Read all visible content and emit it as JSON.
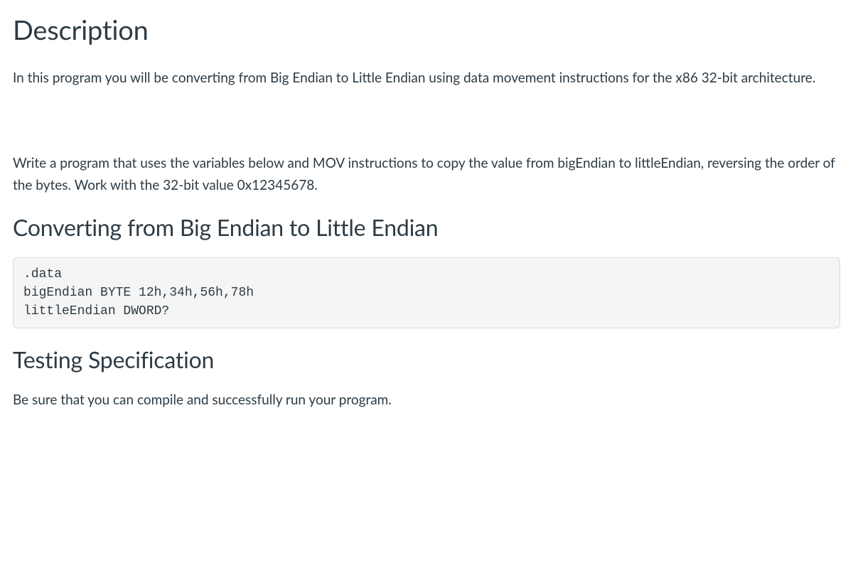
{
  "headings": {
    "description": "Description",
    "converting": "Converting from Big Endian to Little Endian",
    "testing": "Testing Specification"
  },
  "paragraphs": {
    "intro": "In this program you will be converting from Big Endian to Little Endian using data movement instructions for the x86 32-bit architecture.",
    "task": "Write a program that uses the variables below and MOV instructions to copy the value from bigEndian to littleEndian, reversing the order of the bytes.  Work with the 32-bit value 0x12345678.",
    "testing": "Be sure that you can compile and successfully run your program."
  },
  "code": {
    "data_block": ".data\nbigEndian BYTE 12h,34h,56h,78h\nlittleEndian DWORD?"
  }
}
